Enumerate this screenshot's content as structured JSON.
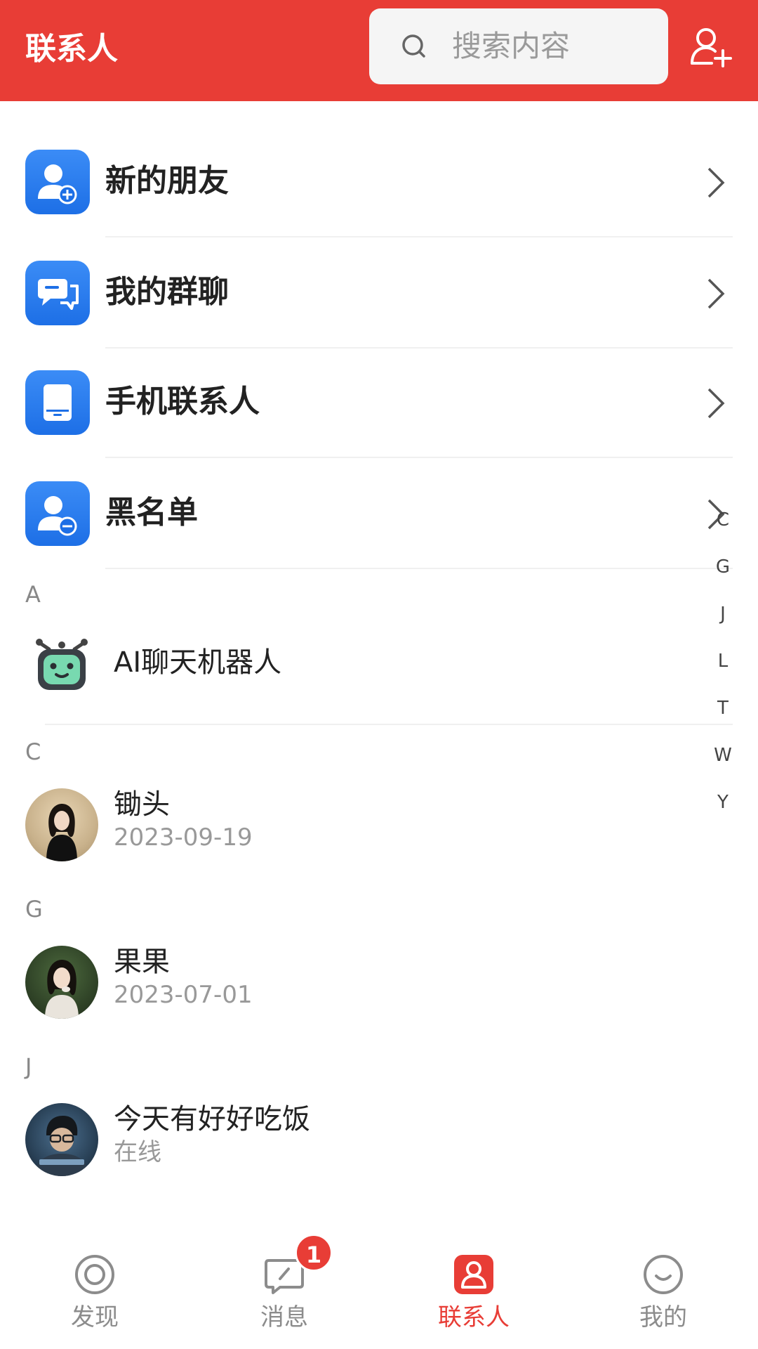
{
  "header": {
    "title": "联系人",
    "search_placeholder": "搜索内容"
  },
  "menu": [
    {
      "label": "新的朋友",
      "icon": "add-friend-icon"
    },
    {
      "label": "我的群聊",
      "icon": "group-chat-icon"
    },
    {
      "label": "手机联系人",
      "icon": "phone-contacts-icon"
    },
    {
      "label": "黑名单",
      "icon": "blacklist-icon"
    }
  ],
  "sections": [
    {
      "letter": "A",
      "contacts": [
        {
          "name": "AI聊天机器人",
          "sub": ""
        }
      ]
    },
    {
      "letter": "C",
      "contacts": [
        {
          "name": "锄头",
          "sub": "2023-09-19"
        }
      ]
    },
    {
      "letter": "G",
      "contacts": [
        {
          "name": "果果",
          "sub": "2023-07-01"
        }
      ]
    },
    {
      "letter": "J",
      "contacts": [
        {
          "name": "今天有好好吃饭",
          "sub": "在线"
        }
      ]
    }
  ],
  "index_letters": [
    "C",
    "G",
    "J",
    "L",
    "T",
    "W",
    "Y"
  ],
  "tabbar": {
    "items": [
      {
        "label": "发现",
        "icon": "discover-icon"
      },
      {
        "label": "消息",
        "icon": "message-icon",
        "badge": "1"
      },
      {
        "label": "联系人",
        "icon": "contacts-icon"
      },
      {
        "label": "我的",
        "icon": "profile-icon"
      }
    ],
    "active_index": 2
  },
  "colors": {
    "brand": "#e83d36",
    "icon_blue": "#1d6fe6"
  }
}
